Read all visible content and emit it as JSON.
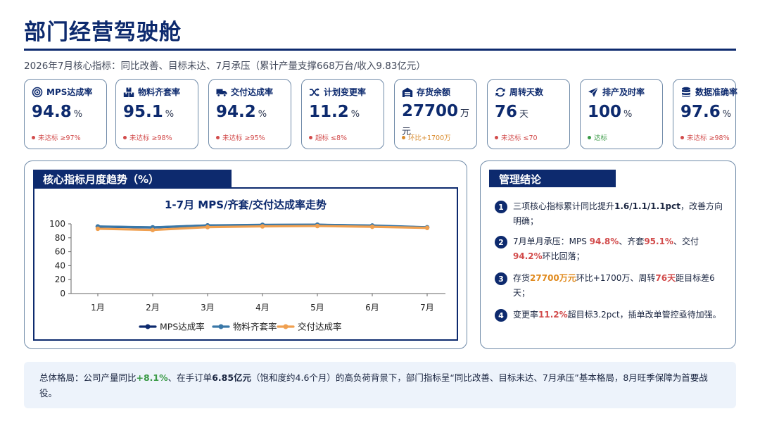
{
  "page": {
    "title": "部门经营驾驶舱",
    "subtitle": "2026年7月核心指标：同比改善、目标未达、7月承压（累计产量支撑668万台/收入9.83亿元）"
  },
  "kpis": [
    {
      "label": "MPS达成率",
      "value": "94.8",
      "unit": "%",
      "status": "未达标 ≥97%",
      "status_color": "#d24b4b",
      "icon": "target-icon"
    },
    {
      "label": "物料齐套率",
      "value": "95.1",
      "unit": "%",
      "status": "未达标 ≥98%",
      "status_color": "#d24b4b",
      "icon": "boxes-icon"
    },
    {
      "label": "交付达成率",
      "value": "94.2",
      "unit": "%",
      "status": "未达标 ≥95%",
      "status_color": "#d24b4b",
      "icon": "truck-icon"
    },
    {
      "label": "计划变更率",
      "value": "11.2",
      "unit": "%",
      "status": "超标 ≤8%",
      "status_color": "#d24b4b",
      "icon": "shuffle-icon"
    },
    {
      "label": "存货余额",
      "value": "27700",
      "unit": "万元",
      "status": "环比+1700万",
      "status_color": "#d98a2b",
      "icon": "warehouse-icon"
    },
    {
      "label": "周转天数",
      "value": "76",
      "unit": "天",
      "status": "未达标 ≤70",
      "status_color": "#d24b4b",
      "icon": "refresh-icon"
    },
    {
      "label": "排产及时率",
      "value": "100",
      "unit": "%",
      "status": "达标",
      "status_color": "#3a9a46",
      "icon": "send-icon"
    },
    {
      "label": "数据准确率",
      "value": "97.6",
      "unit": "%",
      "status": "未达标 ≥98%",
      "status_color": "#d24b4b",
      "icon": "database-icon"
    }
  ],
  "trend_panel": {
    "tag": "核心指标月度趋势（%）"
  },
  "chart_data": {
    "type": "line",
    "title": "1-7月 MPS/齐套/交付达成率走势",
    "categories": [
      "1月",
      "2月",
      "3月",
      "4月",
      "5月",
      "6月",
      "7月"
    ],
    "series": [
      {
        "name": "MPS达成率",
        "color": "#0d2a6e",
        "values": [
          96.0,
          94.8,
          97.6,
          98.3,
          98.6,
          97.3,
          94.8
        ]
      },
      {
        "name": "物料齐套率",
        "color": "#3a78a8",
        "values": [
          96.3,
          95.0,
          97.8,
          98.6,
          98.8,
          97.6,
          95.1
        ]
      },
      {
        "name": "交付达成率",
        "color": "#f0a050",
        "values": [
          93.0,
          91.2,
          95.3,
          96.4,
          96.9,
          95.8,
          94.2
        ]
      }
    ],
    "yticks": [
      0,
      20,
      40,
      60,
      80,
      100
    ],
    "ylim": [
      0,
      100
    ],
    "legend": "bottom"
  },
  "conclusion": {
    "tag": "管理结论",
    "items": [
      {
        "index": "1",
        "t1": "三项核心指标累计同比提升",
        "t2": "1.6/1.1/1.1pct",
        "t3": "，改善方向明确；"
      },
      {
        "index": "2",
        "t1": "7月单月承压：MPS ",
        "t2": "94.8%",
        "t3": "、齐套",
        "t4": "95.1%",
        "t5": "、交付",
        "t6": "94.2%",
        "t7": "环比回落；"
      },
      {
        "index": "3",
        "t1": "存货",
        "t2": "27700万元",
        "t3": "环比+1700万、周转",
        "t4": "76天",
        "t5": "距目标差6天；"
      },
      {
        "index": "4",
        "t1": "变更率",
        "t2": "11.2%",
        "t3": "超目标3.2pct，插单改单管控亟待加强。"
      }
    ]
  },
  "summary": {
    "t1": "总体格局：公司产量同比",
    "t2": "+8.1%",
    "t3": "、在手订单",
    "t4": "6.85亿元",
    "t5": "（饱和度约4.6个月）的高负荷背景下，部门指标呈“同比改善、目标未达、7月承压”基本格局，8月旺季保障为首要战役。"
  }
}
